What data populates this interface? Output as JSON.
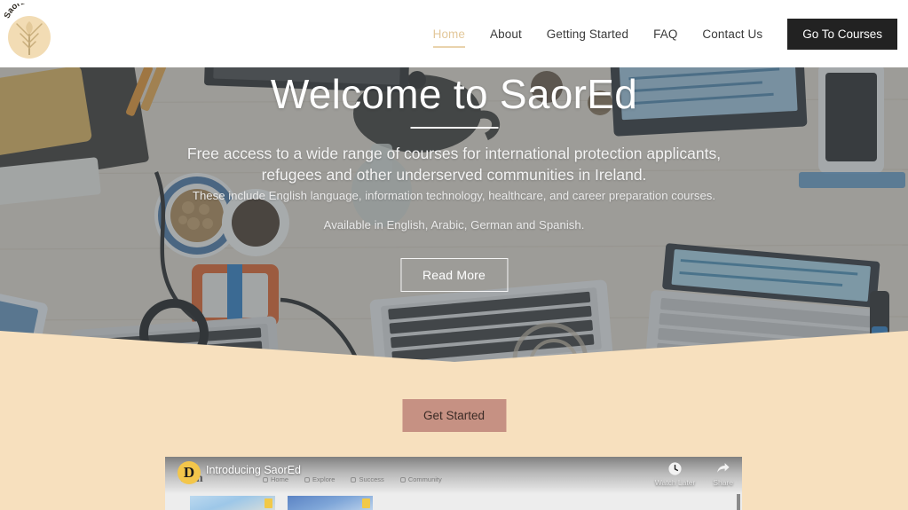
{
  "site": {
    "brand_name": "SaorEd",
    "logo_alt": "SaorEd tree logo"
  },
  "header": {
    "nav_items": [
      {
        "label": "Home",
        "active": true
      },
      {
        "label": "About",
        "active": false
      },
      {
        "label": "Getting Started",
        "active": false
      },
      {
        "label": "FAQ",
        "active": false
      },
      {
        "label": "Contact Us",
        "active": false
      }
    ],
    "cta_label": "Go To Courses",
    "cta_bg": "#222222",
    "active_color": "#e3c89b"
  },
  "hero": {
    "title": "Welcome to SaorEd",
    "lead": "Free access to a wide range of courses for international protection applicants, refugees and other underserved communities in Ireland.",
    "sub1": "These include English language, information technology, healthcare, and career preparation courses.",
    "sub2": "Available in English, Arabic, German and Spanish.",
    "button_label": "Read More"
  },
  "cta_section": {
    "button_label": "Get Started",
    "background_color": "#f7e0be",
    "button_color": "#c69183"
  },
  "video": {
    "title": "Introducing SaorEd",
    "avatar_letter": "D",
    "watch_later_label": "Watch Later",
    "share_label": "Share",
    "watch_later_icon": "clock-icon",
    "share_icon": "share-arrow-icon",
    "background_page": {
      "brand_fragment": "iron",
      "nav": [
        "Home",
        "Explore",
        "Success",
        "Community"
      ]
    }
  }
}
